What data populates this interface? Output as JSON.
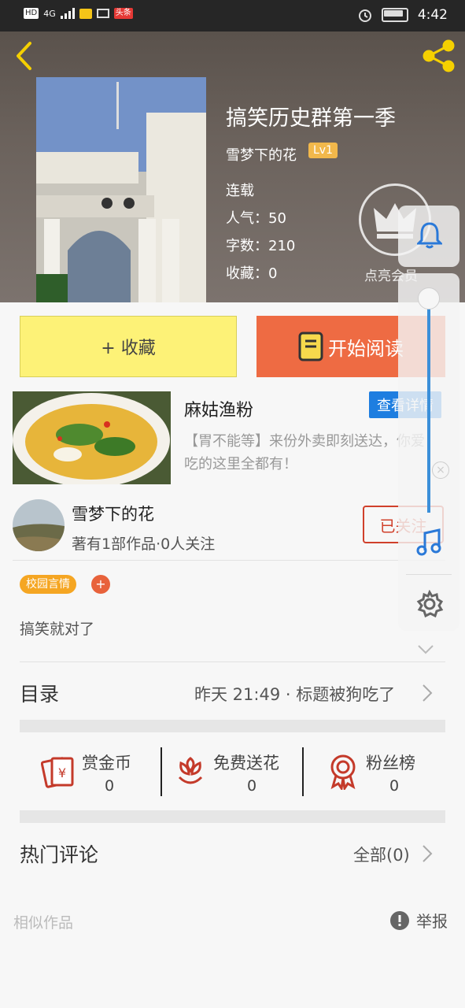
{
  "status_bar": {
    "left_icons": [
      "HD",
      "4G",
      "signal",
      "mail",
      "mail",
      "头条"
    ],
    "time": "4:42"
  },
  "book": {
    "title": "搞笑历史群第一季",
    "author": "雪梦下的花",
    "level": "Lv1",
    "state": "连载",
    "popularity": "人气：50",
    "word_count": "字数：210",
    "favorites": "收藏：0",
    "vip_text": "点亮会员"
  },
  "actions": {
    "collect": "+ 收藏",
    "read": "开始阅读"
  },
  "ad": {
    "name": "麻姑渔粉",
    "detail_button": "查看详情",
    "description": "【胃不能等】来份外卖即刻送达，你爱吃的这里全都有！"
  },
  "author_card": {
    "name": "雪梦下的花",
    "stats": "著有1部作品·0人关注",
    "follow_button": "已关注"
  },
  "tags": [
    "校园言情"
  ],
  "tag_add": "+",
  "summary": "搞笑就对了",
  "catalog": {
    "label": "目录",
    "latest": "昨天 21:49 · 标题被狗吃了"
  },
  "stats": [
    {
      "label": "赏金币",
      "value": "0"
    },
    {
      "label": "免费送花",
      "value": "0"
    },
    {
      "label": "粉丝榜",
      "value": "0"
    }
  ],
  "comments": {
    "label": "热门评论",
    "all": "全部(0)"
  },
  "footer": {
    "similar": "相似作品",
    "report": "举报"
  },
  "colors": {
    "accent": "#ee6b43",
    "collect_bg": "#fdf277",
    "panel_blue": "#3b8fd9",
    "red": "#d32f2f"
  }
}
